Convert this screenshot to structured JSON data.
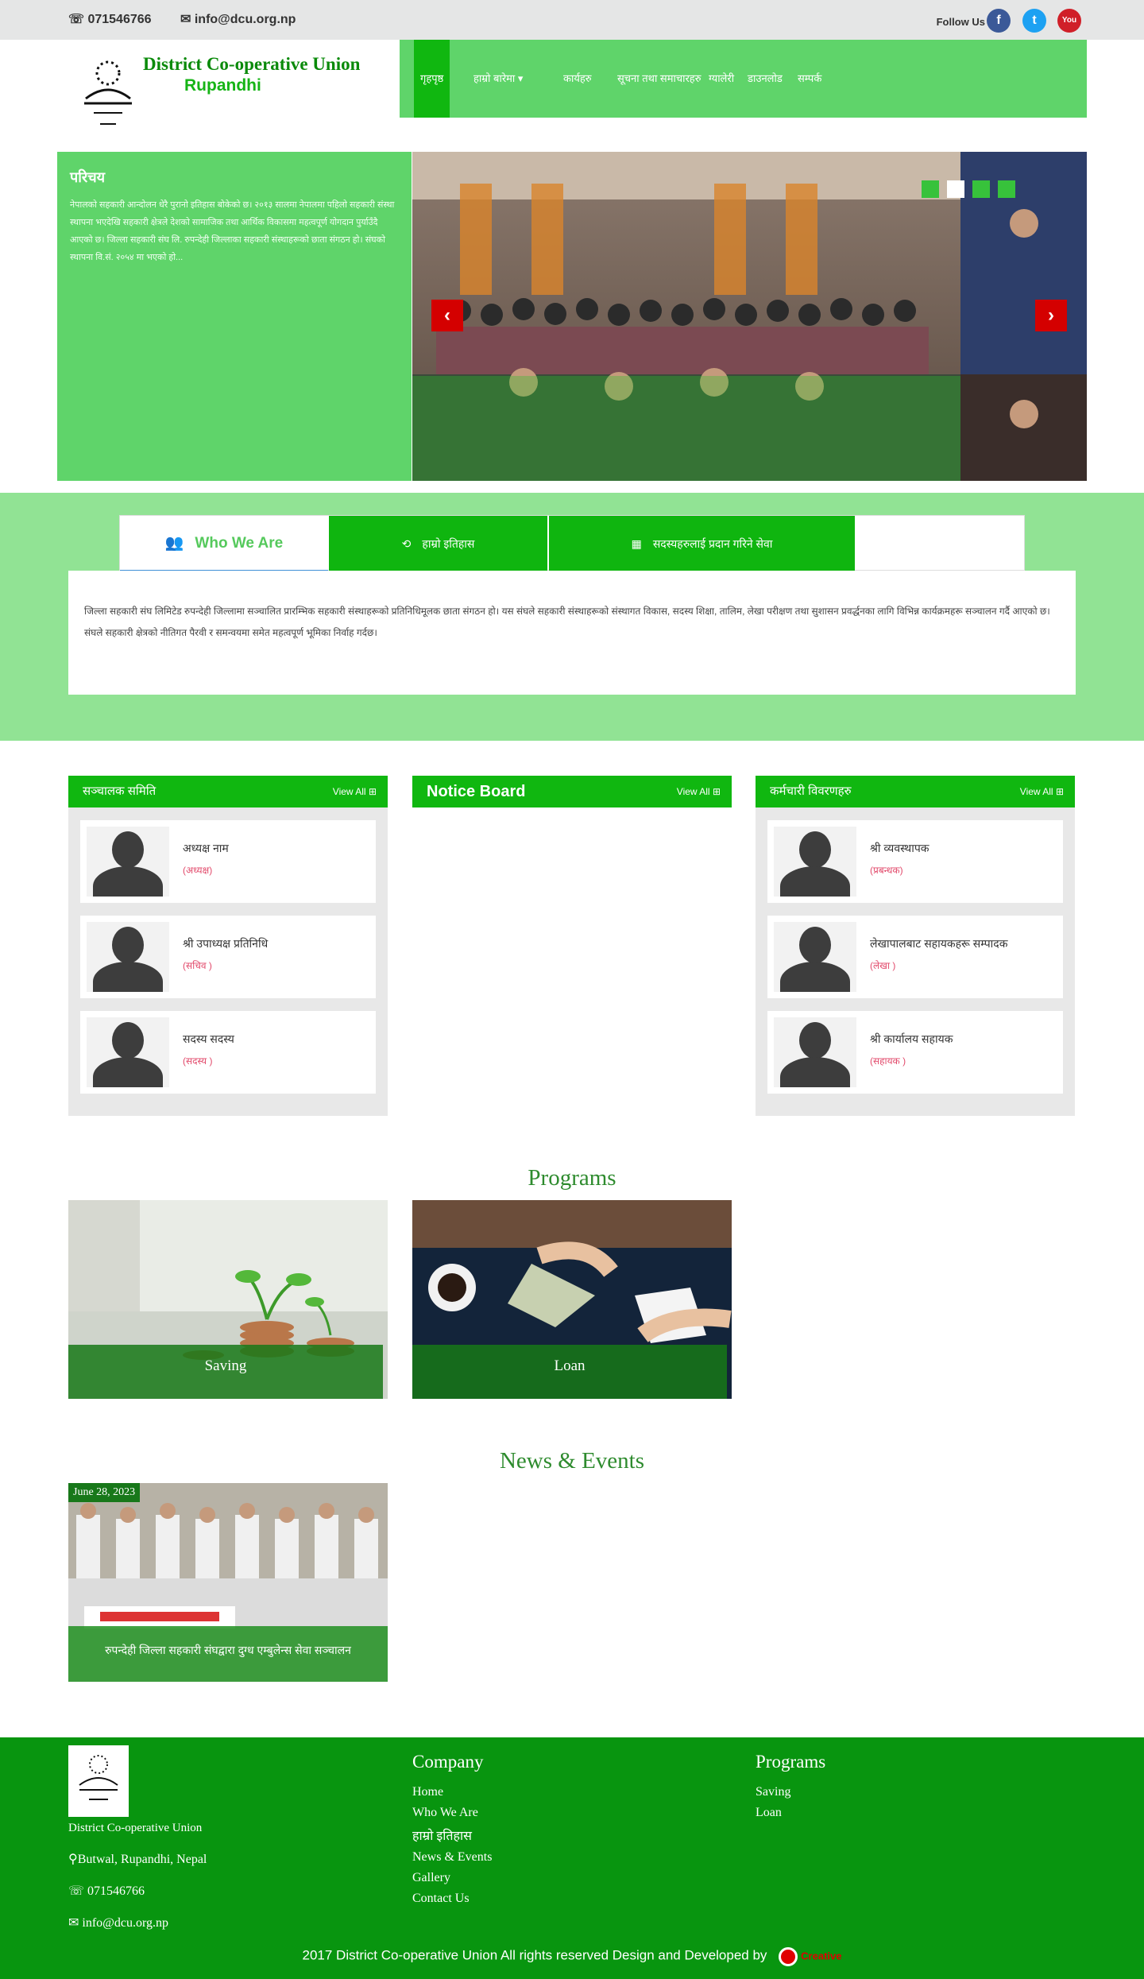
{
  "topbar": {
    "phone": "071546766",
    "email": "info@dcu.org.np",
    "follow_label": "Follow Us",
    "social": {
      "facebook": "f",
      "twitter": "t",
      "youtube": "You Tube"
    }
  },
  "header": {
    "title": "District Co-operative Union",
    "subtitle": "Rupandhi"
  },
  "nav": {
    "items": [
      "गृहपृष्ठ",
      "हाम्रो बारेमा",
      "कार्यहरु",
      "सूचना तथा समाचारहरु",
      "ग्यालेरी",
      "डाउनलोड",
      "सम्पर्क"
    ]
  },
  "hero": {
    "title": "परिचय",
    "text": "नेपालको सहकारी आन्दोलन धेरै पुरानो इतिहास बोकेको छ। २०१३ सालमा नेपालमा पहिलो सहकारी संस्था स्थापना भएदेखि सहकारी क्षेत्रले देशको सामाजिक तथा आर्थिक विकासमा महत्वपूर्ण योगदान पुर्याउँदै आएको छ। जिल्ला सहकारी संघ लि. रुपन्देही जिल्लाका सहकारी संस्थाहरूको छाता संगठन हो। संघको स्थापना वि.सं. २०५४ मा भएको हो..."
  },
  "tabs": {
    "who": "Who We Are",
    "history": "हाम्रो इतिहास",
    "services": "सदस्यहरुलाई प्रदान गरिने सेवा"
  },
  "about": {
    "text": "जिल्ला सहकारी संघ लिमिटेड रुपन्देही जिल्लामा सञ्चालित प्रारम्भिक सहकारी संस्थाहरूको प्रतिनिधिमूलक छाता संगठन हो। यस संघले सहकारी संस्थाहरूको संस्थागत विकास, सदस्य शिक्षा, तालिम, लेखा परीक्षण तथा सुशासन प्रवर्द्धनका लागि विभिन्न कार्यक्रमहरू सञ्चालन गर्दै आएको छ। संघले सहकारी क्षेत्रको नीतिगत पैरवी र समन्वयमा समेत महत्वपूर्ण भूमिका निर्वाह गर्दछ।"
  },
  "panels": {
    "board": {
      "title": "सञ्चालक समिति",
      "view_all": "View All",
      "members": [
        {
          "name": "अध्यक्ष नाम",
          "role": "(अध्यक्ष)"
        },
        {
          "name": "श्री उपाध्यक्ष प्रतिनिधि",
          "role": "(सचिव )"
        },
        {
          "name": "सदस्य सदस्य",
          "role": "(सदस्य )"
        }
      ]
    },
    "notice": {
      "title": "Notice Board",
      "view_all": "View All"
    },
    "staff": {
      "title": "कर्मचारी विवरणहरु",
      "view_all": "View All",
      "members": [
        {
          "name": "श्री व्यवस्थापक",
          "role": "(प्रबन्धक)"
        },
        {
          "name": "लेखापालबाट सहायकहरू सम्पादक",
          "role": "(लेखा )"
        },
        {
          "name": "श्री कार्यालय सहायक",
          "role": "(सहायक )"
        }
      ]
    }
  },
  "programs": {
    "title": "Programs",
    "items": [
      {
        "label": "Saving"
      },
      {
        "label": "Loan"
      }
    ]
  },
  "news": {
    "title": "News & Events",
    "items": [
      {
        "date": "June 28, 2023",
        "caption": "रुपन्देही जिल्ला सहकारी संघद्वारा दुग्ध एम्बुलेन्स सेवा सञ्चालन"
      }
    ]
  },
  "footer": {
    "org": "District Co-operative Union",
    "address": "Butwal, Rupandhi, Nepal",
    "phone": "071546766",
    "email": "info@dcu.org.np",
    "company_title": "Company",
    "company_links": [
      "Home",
      "Who We Are",
      "हाम्रो इतिहास",
      "News & Events",
      "Gallery",
      "Contact Us"
    ],
    "programs_title": "Programs",
    "program_links": [
      "Saving",
      "Loan"
    ],
    "copyright": "2017 District Co-operative Union All rights reserved Design and Developed by",
    "developer": "Creative"
  },
  "colors": {
    "primary_green": "#10b710",
    "light_green": "#5fd46a",
    "band_green": "#91e394",
    "footer_green": "#08950f",
    "accent_red": "#d40000"
  }
}
